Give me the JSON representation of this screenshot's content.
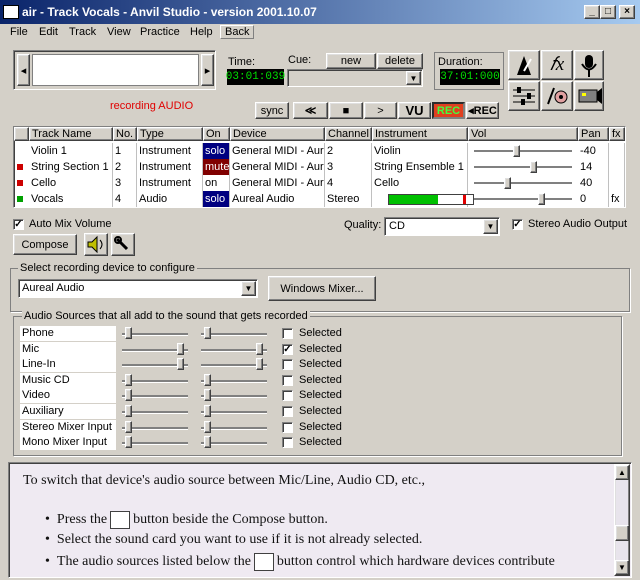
{
  "window": {
    "title": "air - Track Vocals - Anvil Studio - version 2001.10.07",
    "controls": [
      "_",
      "□",
      "×"
    ]
  },
  "menu": [
    "File",
    "Edit",
    "Track",
    "View",
    "Practice",
    "Help",
    "Back"
  ],
  "transport": {
    "time_label": "Time:",
    "time_value": "03:01:039",
    "cue_label": "Cue:",
    "cue_new": "new",
    "cue_delete": "delete",
    "duration_label": "Duration:",
    "duration_value": "37:01:000",
    "status": "recording AUDIO",
    "sync": "sync",
    "rewind": "≪",
    "stop": "■",
    "play": ">",
    "vu": "VU",
    "rec": "REC",
    "erase_rec": "◂REC"
  },
  "tracks": {
    "headers": [
      "Track Name",
      "No.",
      "Type",
      "On",
      "Device",
      "Channel",
      "Instrument",
      "Vol",
      "Pan",
      "fx"
    ],
    "rows": [
      {
        "name": "Violin 1",
        "no": "1",
        "type": "Instrument",
        "on": "solo",
        "device": "General MIDI - Aure",
        "channel": "2",
        "instrument": "Violin",
        "vol": 0.43,
        "pan": "-40",
        "fx": "",
        "marker": ""
      },
      {
        "name": "String Section 1",
        "no": "2",
        "type": "Instrument",
        "on": "mute",
        "device": "General MIDI - Aure",
        "channel": "3",
        "instrument": "String Ensemble 1",
        "vol": 0.6,
        "pan": "14",
        "fx": "",
        "marker": "#cc0000"
      },
      {
        "name": "Cello",
        "no": "3",
        "type": "Instrument",
        "on": "on",
        "device": "General MIDI - Aure",
        "channel": "4",
        "instrument": "Cello",
        "vol": 0.34,
        "pan": "40",
        "fx": "",
        "marker": "#cc0000"
      },
      {
        "name": "Vocals",
        "no": "4",
        "type": "Audio",
        "on": "solo",
        "device": "Aureal Audio",
        "channel": "Stereo",
        "instrument": "",
        "vol": 0.68,
        "pan": "0",
        "fx": "fx",
        "marker": "#00a000"
      }
    ]
  },
  "options": {
    "auto_mix": "Auto Mix Volume",
    "quality_label": "Quality:",
    "quality_value": "CD",
    "stereo_output": "Stereo Audio Output",
    "compose": "Compose"
  },
  "device": {
    "group_title": "Select recording device to configure",
    "selected": "Aureal Audio",
    "mixer_button": "Windows Mixer..."
  },
  "sources": {
    "group_title": "Audio Sources that all add to the sound that gets recorded",
    "selected_label": "Selected",
    "items": [
      {
        "name": "Phone",
        "left": 0.05,
        "right": 0.05,
        "selected": false
      },
      {
        "name": "Mic",
        "left": 0.95,
        "right": 0.95,
        "selected": true
      },
      {
        "name": "Line-In",
        "left": 0.95,
        "right": 0.95,
        "selected": false
      },
      {
        "name": "Music CD",
        "left": 0.05,
        "right": 0.05,
        "selected": false
      },
      {
        "name": "Video",
        "left": 0.05,
        "right": 0.05,
        "selected": false
      },
      {
        "name": "Auxiliary",
        "left": 0.05,
        "right": 0.05,
        "selected": false
      },
      {
        "name": "Stereo Mixer Input",
        "left": 0.05,
        "right": 0.05,
        "selected": false
      },
      {
        "name": "Mono Mixer Input",
        "left": 0.05,
        "right": 0.05,
        "selected": false
      }
    ]
  },
  "help": {
    "line1": "To switch that device's audio source between Mic/Line, Audio CD, etc.,",
    "b1a": "Press the",
    "b1b": "button beside the Compose button.",
    "b2": "Select the sound card you want to use if it is not already selected.",
    "b3a": "The audio sources listed below the",
    "b3b": "button control which hardware devices contribute"
  }
}
